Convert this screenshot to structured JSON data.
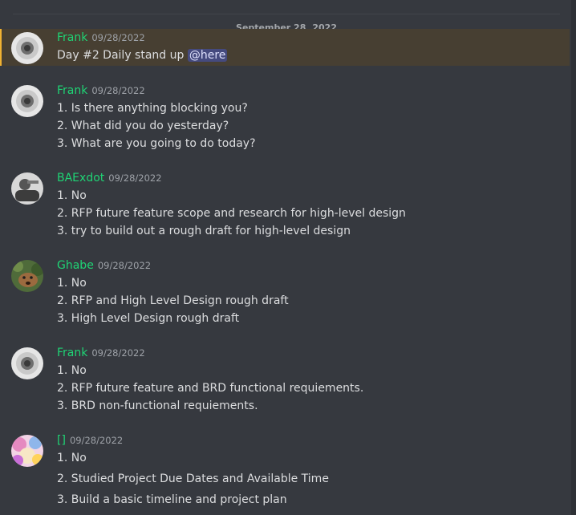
{
  "date_divider": "September 28, 2022",
  "messages": [
    {
      "username": "Frank",
      "timestamp": "09/28/2022",
      "avatar": "frank-avatar",
      "mention_highlight": true,
      "text": "Day #2 Daily stand up",
      "mention": "@here"
    },
    {
      "username": "Frank",
      "timestamp": "09/28/2022",
      "avatar": "frank-avatar",
      "lines": [
        "1. Is there anything blocking you?",
        "2. What did you do yesterday?",
        "3. What are you going to do today?"
      ]
    },
    {
      "username": "BAExdot",
      "timestamp": "09/28/2022",
      "avatar": "baexdot-avatar",
      "lines": [
        "1. No",
        "2. RFP future feature scope and research for high-level design",
        "3. try to build out a rough draft for high-level design"
      ]
    },
    {
      "username": "Ghabe",
      "timestamp": "09/28/2022",
      "avatar": "ghabe-avatar",
      "lines": [
        "1. No",
        "2. RFP and High Level Design rough draft",
        "3. High Level Design rough draft"
      ]
    },
    {
      "username": "Frank",
      "timestamp": "09/28/2022",
      "avatar": "frank-avatar",
      "lines": [
        "1. No",
        "2. RFP future feature and BRD functional requiements.",
        "3. BRD non-functional requiements."
      ]
    },
    {
      "username": "[]",
      "timestamp": "09/28/2022",
      "avatar": "anime-avatar",
      "lines": [
        "1. No",
        "2. Studied Project Due Dates and Available Time",
        "3. Build a basic timeline and project plan"
      ]
    }
  ],
  "colors": {
    "background": "#36393f",
    "username": "#1fd475",
    "text": "#dcdddf",
    "timestamp": "#9ea2a8",
    "mention_bg": "#473f32",
    "mention_bar": "#f0b232"
  }
}
